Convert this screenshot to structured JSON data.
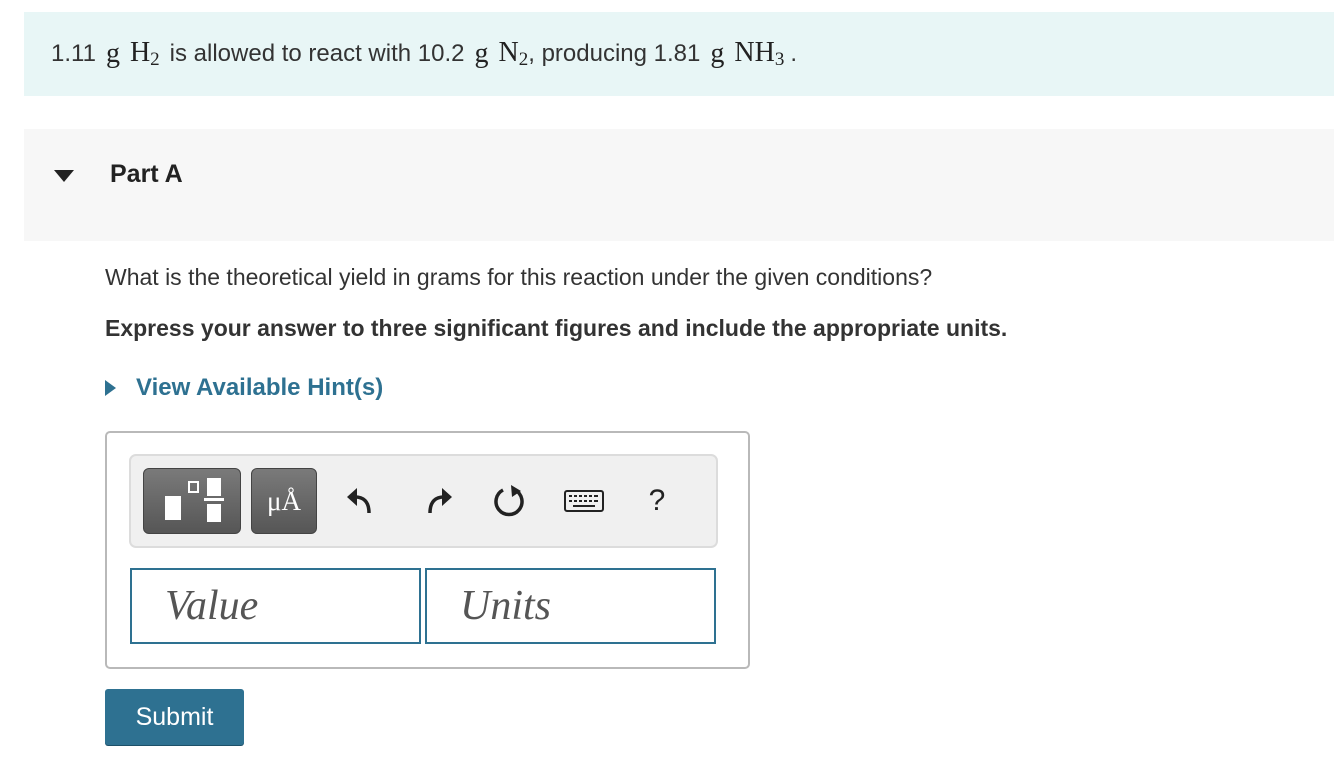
{
  "problem": {
    "mass_h2": "1.11",
    "g1": "g",
    "h2_base": "H",
    "h2_sub": "2",
    "text1": "is allowed to react with 10.2",
    "g2": "g",
    "n2_base": "N",
    "n2_sub": "2",
    "text2": ", producing 1.81",
    "g3": "g",
    "nh3_base": "NH",
    "nh3_sub": "3",
    "text3": "."
  },
  "part": {
    "title": "Part A",
    "question": "What is the theoretical yield in grams for this reaction under the given conditions?",
    "instruction": "Express your answer to three significant figures and include the appropriate units.",
    "hint_label": "View Available Hint(s)"
  },
  "toolbar": {
    "units_label": "μÅ",
    "help_label": "?"
  },
  "answer": {
    "value_placeholder": "Value",
    "units_placeholder": "Units"
  },
  "submit_label": "Submit",
  "colors": {
    "accent": "#2e7191",
    "problem_bg": "#e8f6f6",
    "part_bg": "#f7f7f7"
  }
}
